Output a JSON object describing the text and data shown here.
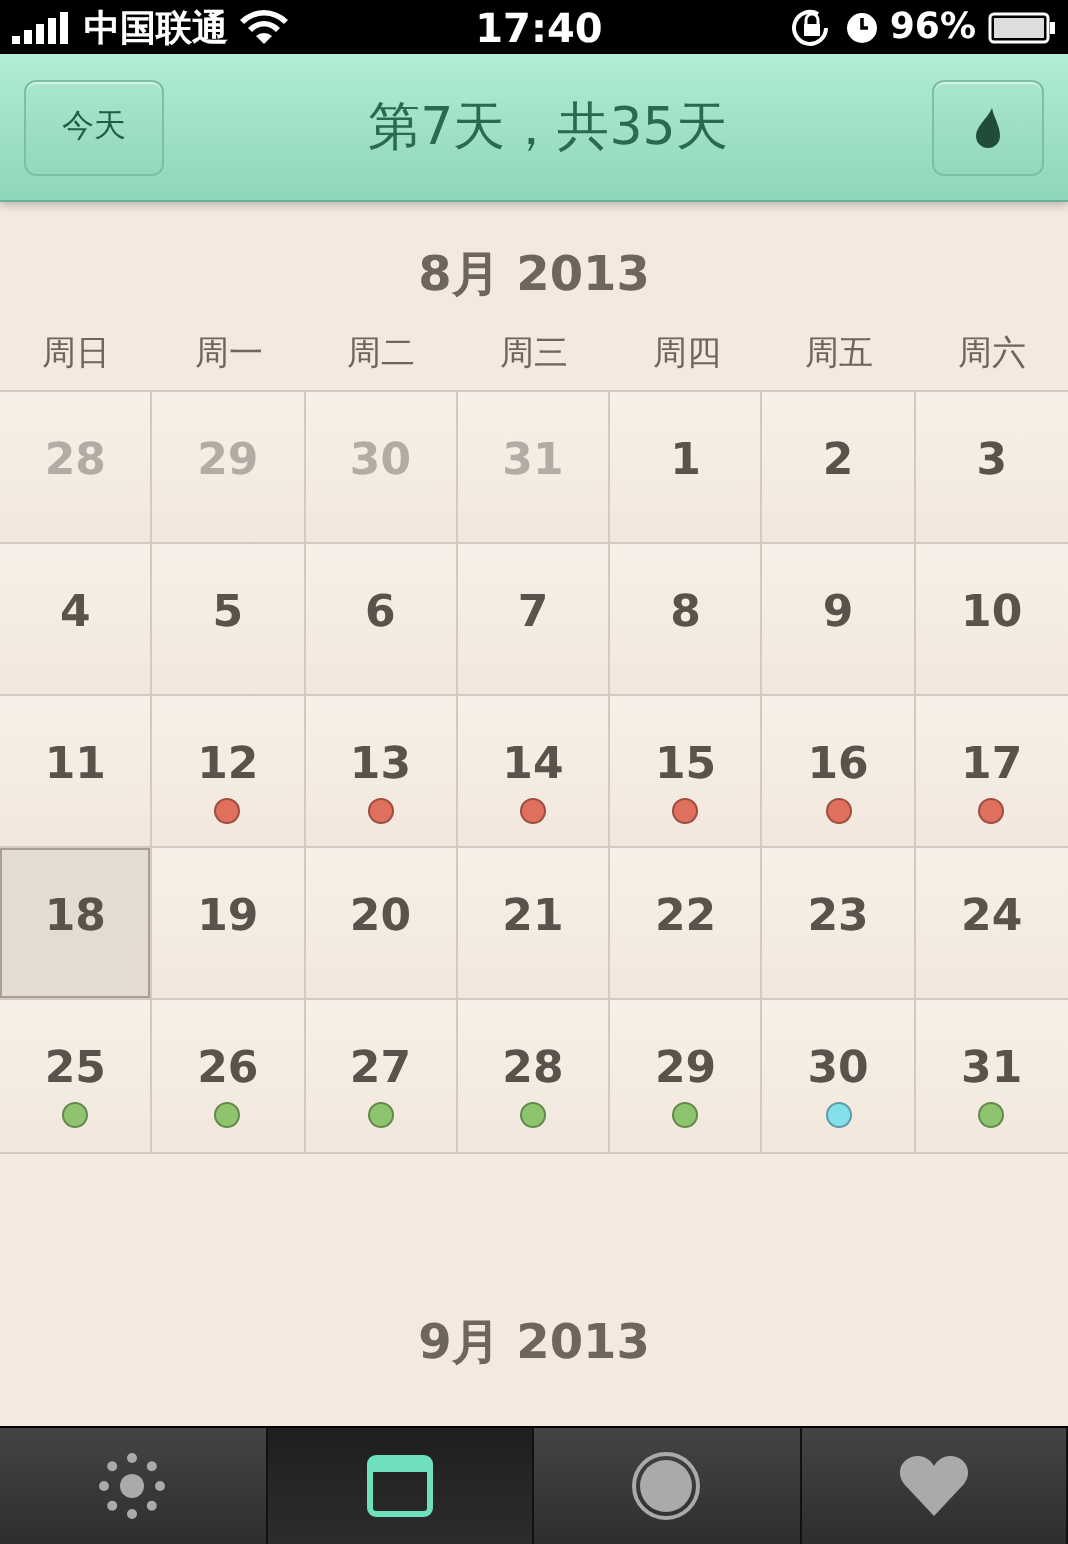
{
  "status_bar": {
    "carrier": "中国联通",
    "time": "17:40",
    "battery": "96%"
  },
  "header": {
    "today_button": "今天",
    "title": "第7天，共35天"
  },
  "months": [
    {
      "title": "8月 2013",
      "weekdays": [
        "周日",
        "周一",
        "周二",
        "周三",
        "周四",
        "周五",
        "周六"
      ],
      "days": [
        {
          "day": "28",
          "muted": true,
          "selected": false
        },
        {
          "day": "29",
          "muted": true,
          "selected": false
        },
        {
          "day": "30",
          "muted": true,
          "selected": false
        },
        {
          "day": "31",
          "muted": true,
          "selected": false
        },
        {
          "day": "1",
          "muted": false,
          "selected": false
        },
        {
          "day": "2",
          "muted": false,
          "selected": false
        },
        {
          "day": "3",
          "muted": false,
          "selected": false
        },
        {
          "day": "4",
          "muted": false,
          "selected": false
        },
        {
          "day": "5",
          "muted": false,
          "selected": false
        },
        {
          "day": "6",
          "muted": false,
          "selected": false
        },
        {
          "day": "7",
          "muted": false,
          "selected": false
        },
        {
          "day": "8",
          "muted": false,
          "selected": false
        },
        {
          "day": "9",
          "muted": false,
          "selected": false
        },
        {
          "day": "10",
          "muted": false,
          "selected": false
        },
        {
          "day": "11",
          "muted": false,
          "selected": false
        },
        {
          "day": "12",
          "muted": false,
          "selected": false,
          "color": "#e0705e"
        },
        {
          "day": "13",
          "muted": false,
          "selected": false,
          "color": "#e0705e"
        },
        {
          "day": "14",
          "muted": false,
          "selected": false,
          "color": "#e0705e"
        },
        {
          "day": "15",
          "muted": false,
          "selected": false,
          "color": "#e0705e"
        },
        {
          "day": "16",
          "muted": false,
          "selected": false,
          "color": "#e0705e"
        },
        {
          "day": "17",
          "muted": false,
          "selected": false,
          "color": "#e0705e"
        },
        {
          "day": "18",
          "muted": false,
          "selected": true
        },
        {
          "day": "19",
          "muted": false,
          "selected": false
        },
        {
          "day": "20",
          "muted": false,
          "selected": false
        },
        {
          "day": "21",
          "muted": false,
          "selected": false
        },
        {
          "day": "22",
          "muted": false,
          "selected": false
        },
        {
          "day": "23",
          "muted": false,
          "selected": false
        },
        {
          "day": "24",
          "muted": false,
          "selected": false
        },
        {
          "day": "25",
          "muted": false,
          "selected": false,
          "color": "#8fc46f"
        },
        {
          "day": "26",
          "muted": false,
          "selected": false,
          "color": "#8fc46f"
        },
        {
          "day": "27",
          "muted": false,
          "selected": false,
          "color": "#8fc46f"
        },
        {
          "day": "28",
          "muted": false,
          "selected": false,
          "color": "#8fc46f"
        },
        {
          "day": "29",
          "muted": false,
          "selected": false,
          "color": "#8fc46f"
        },
        {
          "day": "30",
          "muted": false,
          "selected": false,
          "color": "#86e0ec"
        },
        {
          "day": "31",
          "muted": false,
          "selected": false,
          "color": "#8fc46f"
        }
      ]
    },
    {
      "title": "9月 2013"
    }
  ],
  "tab_bar": [
    {
      "kind": "sun",
      "selected": false
    },
    {
      "kind": "calendar",
      "selected": true
    },
    {
      "kind": "circle",
      "selected": false
    },
    {
      "kind": "heart",
      "selected": false
    }
  ]
}
